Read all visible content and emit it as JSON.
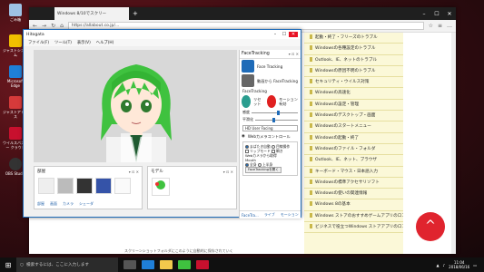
{
  "desktop": {
    "icons": [
      {
        "label": "ごみ箱"
      },
      {
        "label": "ジャストシステム"
      },
      {
        "label": "Microsoft Edge"
      },
      {
        "label": "ジャストアドレス"
      },
      {
        "label": "ウイルスバスター クラウド"
      },
      {
        "label": "OBS Studio"
      }
    ]
  },
  "browser": {
    "tab_title": "Windows 8/10でスクリー",
    "new_tab": "+",
    "url": "https://allabout.co.jp/...",
    "status_text": "スクリーンショットフォルダにこのように自動的に保存されていく",
    "sidebar": [
      "起動・終了・フリーズのトラブル",
      "Windowsの各種設定のトラブル",
      "Outlook、IE、ネットのトラブル",
      "Windowsの原因不明のトラブル",
      "セキュリティ・ウイルス対策",
      "Windowsの高速化",
      "Windowsの設定・管理",
      "Windowsのデスクトップ・画面",
      "Windowsのスタートメニュー",
      "Windowsの起動・終了",
      "Windowsのファイル・フォルダ",
      "Outlook、IE、ネット、ブラウザ",
      "キーボード・マウス・日本語入力",
      "Windowsの標準アクセサリソフト",
      "Windowsの使いの関連情報",
      "Windows 8の基本",
      "Windows ストアのおすすめゲームアプリのロコミ",
      "ビジネスで役立つWindows ストアアプリのロコミ"
    ],
    "fab": "^",
    "footer": "1 前の記事  1 最近の更新を表示 1.50 KB"
  },
  "hitogata": {
    "title": "Hitogata",
    "menu": [
      "ファイル(F)",
      "ツール(T)",
      "表示(V)",
      "ヘルプ(H)"
    ],
    "panel_parts_title": "部屋",
    "panel_parts_tabs": [
      "部屋",
      "画面",
      "カメラ",
      "シェーダ"
    ],
    "panel_model_title": "モデル",
    "face": {
      "title": "FaceTracking",
      "btn1": "Face Tracking",
      "btn2": "動画から FaceTracking",
      "sub": "FaceTracking",
      "reset": "リセット",
      "motion": "モーション 有効",
      "s1": "感度",
      "s2": "平滑化",
      "camera": "HD User Facing",
      "webcam": "Webカメラコントロール",
      "radio1": "まばたき自動",
      "radio2": "目線操作",
      "r3": "リップモード",
      "r4": "瞬き",
      "r5": "Webカメラから取得",
      "mouth": "Mouth",
      "r6": "全身",
      "r7": "上半身",
      "btn3": "FaceTrackingを開く",
      "tabs": [
        "FaceTra...",
        "ライブ",
        "モーション"
      ]
    }
  },
  "taskbar": {
    "search_placeholder": "検索するには、ここに入力します",
    "time": "11:04",
    "date": "2018/06/16"
  }
}
